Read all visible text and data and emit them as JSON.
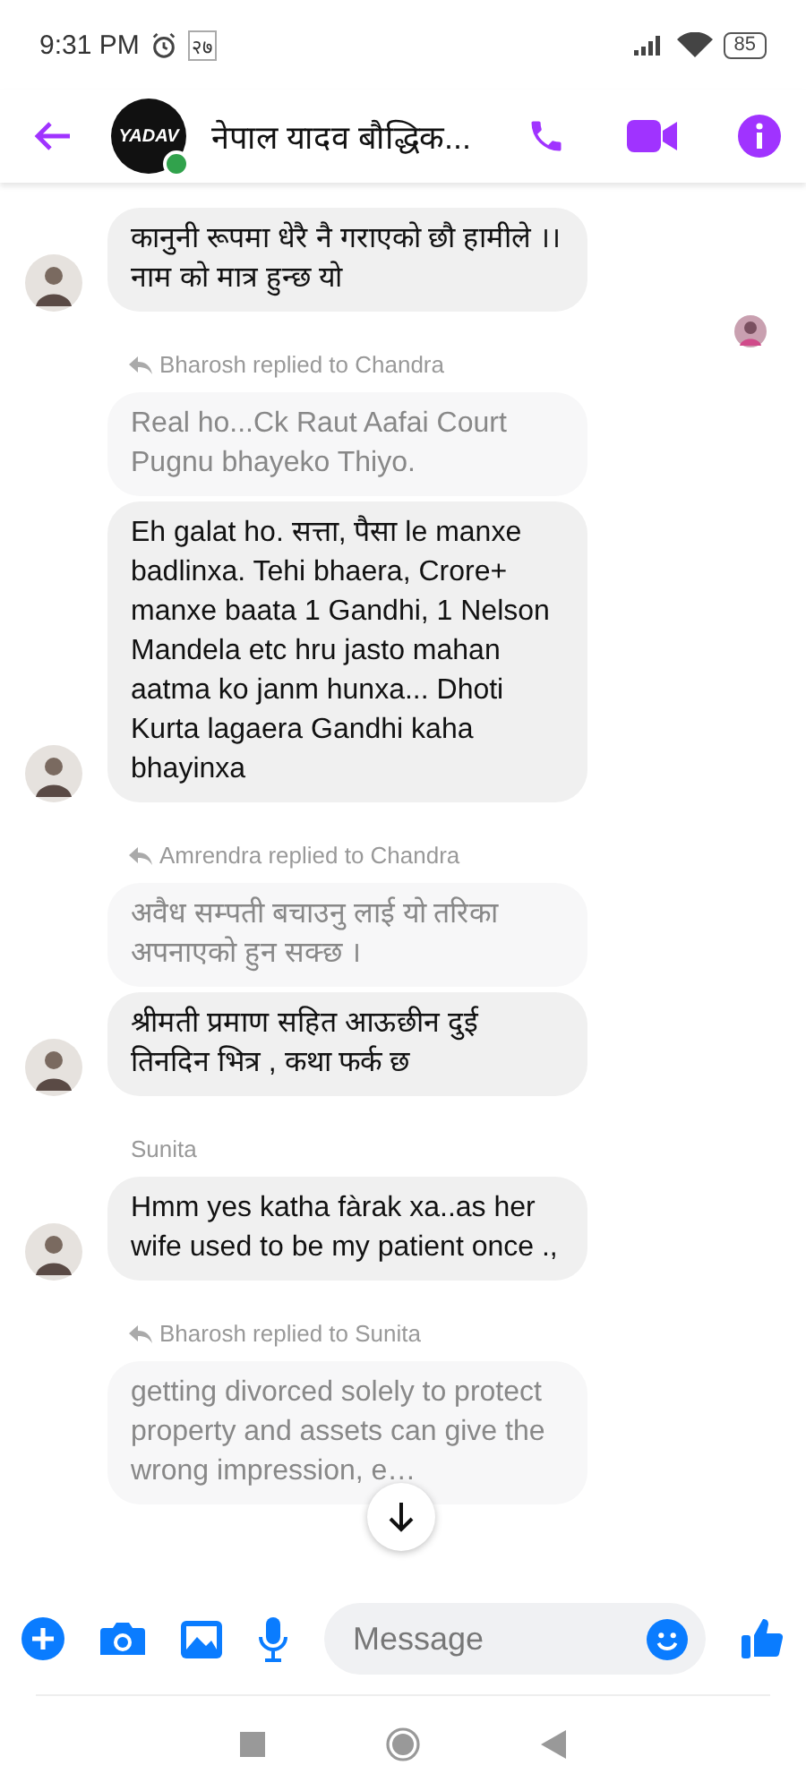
{
  "status_bar": {
    "time": "9:31 PM",
    "notification": "२७",
    "battery": "85"
  },
  "header": {
    "title": "नेपाल यादव बौद्धिक...",
    "avatar_text": "YADAV",
    "online": true
  },
  "groups": [
    {
      "kind": "plain",
      "avatar": true,
      "messages": [
        {
          "kind": "message",
          "text": "कानुनी रूपमा धेरै नै गराएको छौ हामीले ।।नाम को मात्र हुन्छ यो"
        }
      ],
      "seen": true
    },
    {
      "label": "Bharosh replied to Chandra",
      "kind": "reply",
      "avatar": true,
      "messages": [
        {
          "kind": "quote",
          "text": "Real ho...Ck Raut Aafai Court Pugnu bhayeko Thiyo."
        },
        {
          "kind": "message",
          "text": "Eh galat ho. सत्ता, पैसा le manxe badlinxa. Tehi bhaera, Crore+ manxe baata 1 Gandhi, 1 Nelson Mandela etc hru jasto mahan aatma ko janm hunxa... Dhoti Kurta lagaera Gandhi kaha bhayinxa"
        }
      ],
      "seen": false
    },
    {
      "label": "Amrendra replied to Chandra",
      "kind": "reply",
      "avatar": true,
      "messages": [
        {
          "kind": "quote",
          "text": "अवैध सम्पती बचाउनु लाई यो तरिका अपनाएको हुन सक्छ ।"
        },
        {
          "kind": "message",
          "text": "श्रीमती प्रमाण सहित आऊछीन दुई तिनदिन भित्र , कथा फर्क छ"
        }
      ],
      "seen": false
    },
    {
      "label": "Sunita",
      "kind": "name",
      "avatar": true,
      "messages": [
        {
          "kind": "message",
          "text": "Hmm yes katha fàrak xa..as her wife used to be  my patient once .,"
        }
      ],
      "seen": false
    },
    {
      "label": "Bharosh replied to Sunita",
      "kind": "reply",
      "avatar": false,
      "messages": [
        {
          "kind": "quote",
          "text": "getting divorced solely to protect property and assets can give the wrong impression, e…"
        }
      ],
      "seen": false
    }
  ],
  "composer": {
    "placeholder": "Message"
  }
}
